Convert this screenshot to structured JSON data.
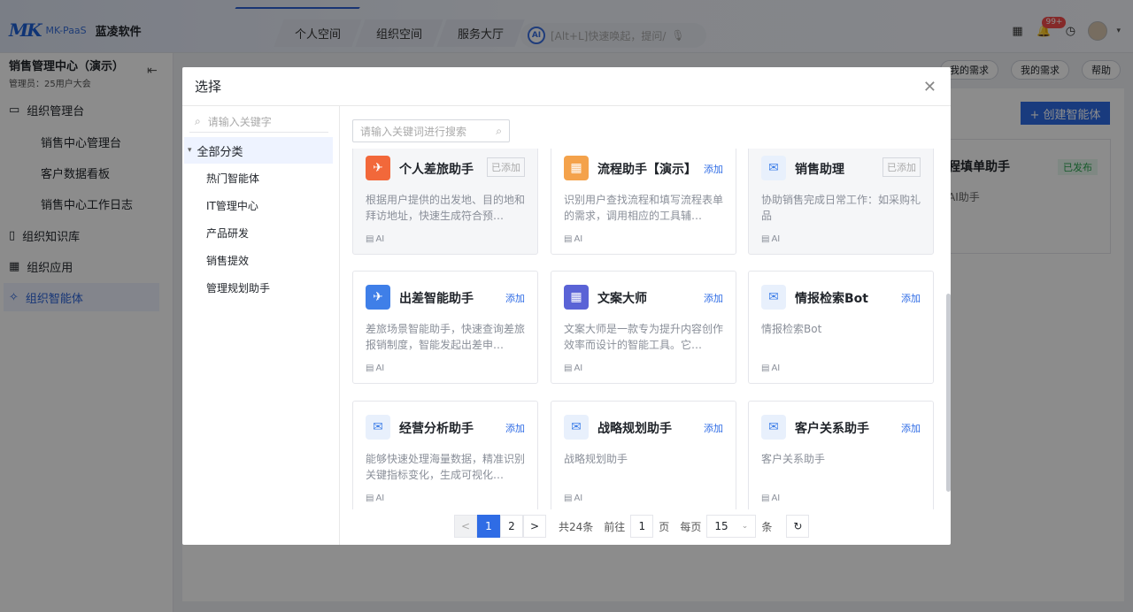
{
  "brand": {
    "mark": "MK",
    "sub": "MK-PaaS",
    "name": "蓝凌软件"
  },
  "nav": {
    "tabs": [
      "个人空间",
      "组织空间",
      "服务大厅"
    ],
    "search_placeholder": "[Alt+L]快速唤起，提问/"
  },
  "header": {
    "notification_count": "99+"
  },
  "sidebar": {
    "title": "销售管理中心（演示）",
    "subtitle": "管理员：25用户大会",
    "items": [
      {
        "label": "组织管理台",
        "icon": "console-icon"
      },
      {
        "label": "销售中心管理台",
        "sub": true
      },
      {
        "label": "客户数据看板",
        "sub": true
      },
      {
        "label": "销售中心工作日志",
        "sub": true
      },
      {
        "label": "组织知识库",
        "icon": "book-icon"
      },
      {
        "label": "组织应用",
        "icon": "apps-icon"
      },
      {
        "label": "组织智能体",
        "icon": "agent-icon",
        "active": true
      }
    ]
  },
  "right": {
    "btn_a": "我的需求",
    "btn_b": "我的需求",
    "btn_c": "帮助",
    "create": "+ 创建智能体",
    "bg_card_title": "程填单助手",
    "bg_card_status": "已发布",
    "bg_card_desc": "AI助手"
  },
  "modal": {
    "title": "选择",
    "left_search_placeholder": "请输入关键字",
    "tree_root": "全部分类",
    "categories": [
      "热门智能体",
      "IT管理中心",
      "产品研发",
      "销售提效",
      "管理规划助手"
    ],
    "right_search_placeholder": "请输入关键词进行搜索",
    "cards": [
      {
        "name": "个人差旅助手",
        "action": "已添加",
        "added": true,
        "desc": "根据用户提供的出发地、目的地和拜访地址，快速生成符合预…",
        "tag": "AI",
        "color": "#f2683a",
        "icon": "plane-icon"
      },
      {
        "name": "流程助手【演示】",
        "action": "添加",
        "added": false,
        "desc": "识别用户查找流程和填写流程表单的需求，调用相应的工具辅…",
        "tag": "AI",
        "color": "#f4a24b",
        "icon": "grid-icon"
      },
      {
        "name": "销售助理",
        "action": "已添加",
        "added": true,
        "desc": "协助销售完成日常工作：如采购礼品",
        "tag": "AI",
        "color": "#e8f0fc",
        "icon": "chat-icon"
      },
      {
        "name": "出差智能助手",
        "action": "添加",
        "added": false,
        "desc": "差旅场景智能助手，快速查询差旅报销制度，智能发起出差申…",
        "tag": "AI",
        "color": "#3f7fe8",
        "icon": "plane-icon"
      },
      {
        "name": "文案大师",
        "action": "添加",
        "added": false,
        "desc": "文案大师是一款专为提升内容创作效率而设计的智能工具。它…",
        "tag": "AI",
        "color": "#5a63d6",
        "icon": "grid-icon"
      },
      {
        "name": "情报检索Bot",
        "action": "添加",
        "added": false,
        "desc": "情报检索Bot",
        "tag": "AI",
        "color": "#e8f0fc",
        "icon": "chat-icon"
      },
      {
        "name": "经营分析助手",
        "action": "添加",
        "added": false,
        "desc": "能够快速处理海量数据，精准识别关键指标变化，生成可视化…",
        "tag": "AI",
        "color": "#e8f0fc",
        "icon": "chat-icon"
      },
      {
        "name": "战略规划助手",
        "action": "添加",
        "added": false,
        "desc": "战略规划助手",
        "tag": "AI",
        "color": "#e8f0fc",
        "icon": "chat-icon"
      },
      {
        "name": "客户关系助手",
        "action": "添加",
        "added": false,
        "desc": "客户关系助手",
        "tag": "AI",
        "color": "#e8f0fc",
        "icon": "chat-icon"
      }
    ],
    "pager": {
      "prev": "<",
      "pages": [
        "1",
        "2"
      ],
      "next": ">",
      "total": "共24条",
      "goto_label": "前往",
      "goto_value": "1",
      "page_unit": "页",
      "per_page_label": "每页",
      "per_page_value": "15",
      "per_page_unit": "条"
    }
  }
}
